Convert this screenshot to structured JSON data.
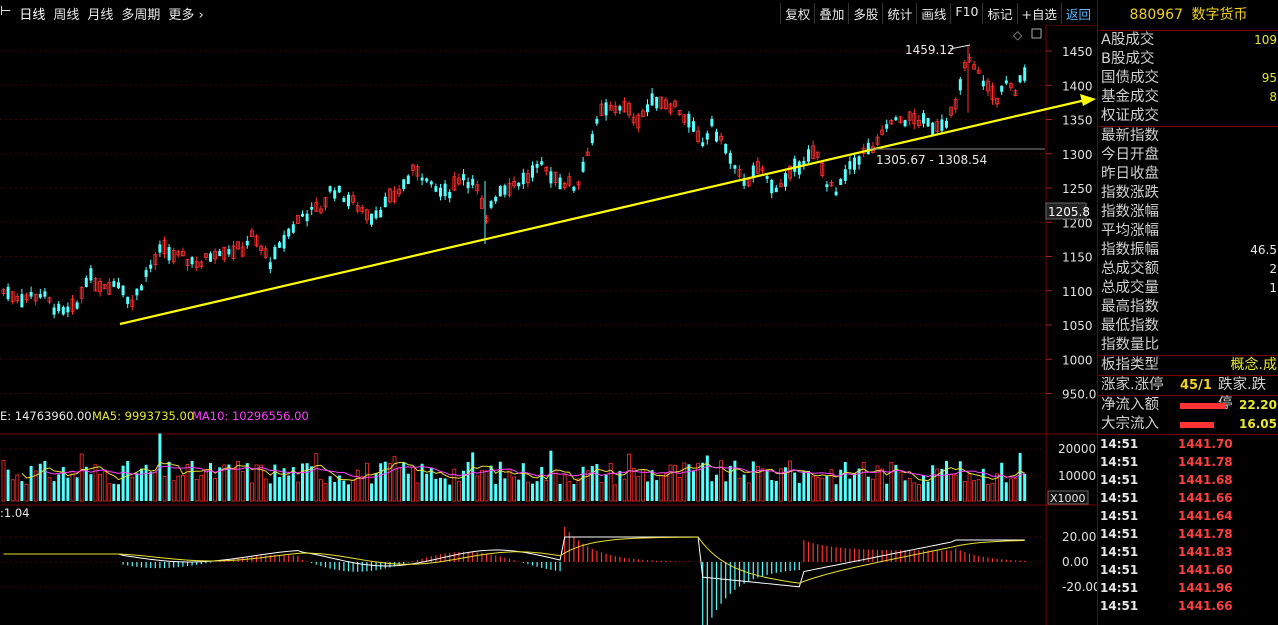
{
  "toolbar": {
    "left": [
      "日线",
      "周线",
      "月线",
      "多周期",
      "更多 ›"
    ],
    "right": [
      "复权",
      "叠加",
      "多股",
      "统计",
      "画线",
      "F10",
      "标记",
      "+自选",
      "返回"
    ]
  },
  "chart": {
    "price_axis": [
      "1450",
      "1400",
      "1350",
      "1300",
      "1250",
      "1200",
      "1150",
      "1100",
      "1050",
      "1000",
      "950.0"
    ],
    "current_price_label": "1205.8",
    "high_annotation": "1459.12",
    "range_annotation": "1305.67 - 1308.54",
    "volume_legend": {
      "vol": "E: 14763960.00",
      "ma5": "MA5: 9993735.00",
      "ma10": "MA10: 10296556.00"
    },
    "volume_axis": [
      "20000",
      "10000"
    ],
    "volume_unit": "X1000",
    "macd_legend": ":1.04",
    "macd_axis": [
      "20.00",
      "0.00",
      "-20.00"
    ],
    "colors": {
      "up": "#ff3030",
      "down": "#54ffff",
      "ma5": "#ffffff",
      "ma10": "#e8e030",
      "ma10v": "#ff40ff",
      "trend": "#ffff00"
    }
  },
  "panel": {
    "code": "880967",
    "name": "数字货币",
    "trade_rows": [
      {
        "label": "A股成交",
        "value": "109"
      },
      {
        "label": "B股成交",
        "value": ""
      },
      {
        "label": "国债成交",
        "value": "95"
      },
      {
        "label": "基金成交",
        "value": "8"
      },
      {
        "label": "权证成交",
        "value": ""
      }
    ],
    "index_rows": [
      {
        "label": "最新指数",
        "value": ""
      },
      {
        "label": "今日开盘",
        "value": ""
      },
      {
        "label": "昨日收盘",
        "value": ""
      },
      {
        "label": "指数涨跌",
        "value": ""
      },
      {
        "label": "指数涨幅",
        "value": ""
      },
      {
        "label": "平均涨幅",
        "value": ""
      },
      {
        "label": "指数振幅",
        "value": "46.5"
      },
      {
        "label": "总成交额",
        "value": "2"
      },
      {
        "label": "总成交量",
        "value": "1"
      },
      {
        "label": "最高指数",
        "value": ""
      },
      {
        "label": "最低指数",
        "value": ""
      },
      {
        "label": "指数量比",
        "value": ""
      }
    ],
    "type_label": "板指类型",
    "type_value": "概念.成",
    "updown_label": "涨家.涨停",
    "updown_value": "45/1",
    "down_label": "跌家.跌停",
    "flows": [
      {
        "label": "净流入额",
        "value": "22.20"
      },
      {
        "label": "大宗流入",
        "value": "16.05"
      }
    ],
    "ticks": [
      {
        "t": "14:51",
        "p": "1441.70"
      },
      {
        "t": "14:51",
        "p": "1441.78"
      },
      {
        "t": "14:51",
        "p": "1441.68"
      },
      {
        "t": "14:51",
        "p": "1441.66"
      },
      {
        "t": "14:51",
        "p": "1441.64"
      },
      {
        "t": "14:51",
        "p": "1441.78"
      },
      {
        "t": "14:51",
        "p": "1441.83"
      },
      {
        "t": "14:51",
        "p": "1441.60"
      },
      {
        "t": "14:51",
        "p": "1441.96"
      },
      {
        "t": "14:51",
        "p": "1441.66"
      }
    ]
  }
}
